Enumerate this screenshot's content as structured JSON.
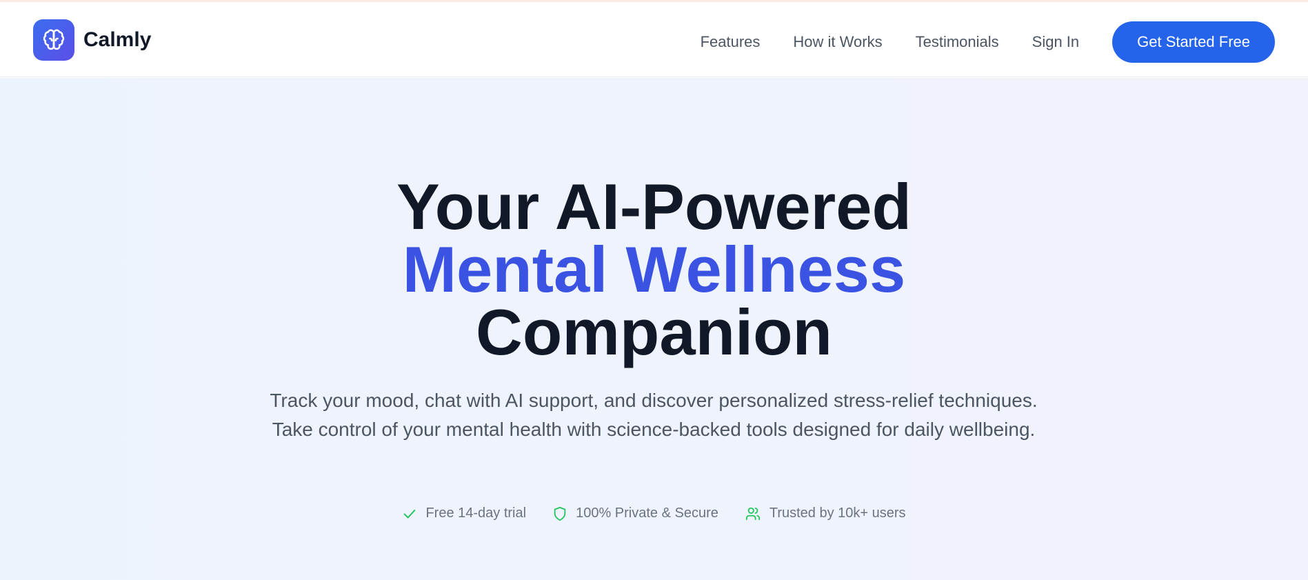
{
  "brand": {
    "name": "Calmly",
    "logo_icon": "brain-icon",
    "accent": "#2563eb"
  },
  "nav": {
    "links": [
      "Features",
      "How it Works",
      "Testimonials",
      "Sign In"
    ],
    "cta_label": "Get Started Free"
  },
  "hero": {
    "title_line1": "Your AI-Powered",
    "title_line2": "Mental Wellness",
    "title_line3": "Companion",
    "highlight_color": "#3b53e3",
    "subtitle": "Track your mood, chat with AI support, and discover personalized stress-relief techniques. Take control of your mental health with science-backed tools designed for daily wellbeing."
  },
  "badges": [
    {
      "icon": "check-icon",
      "label": "Free 14-day trial"
    },
    {
      "icon": "shield-icon",
      "label": "100% Private & Secure"
    },
    {
      "icon": "users-icon",
      "label": "Trusted by 10k+ users"
    }
  ]
}
